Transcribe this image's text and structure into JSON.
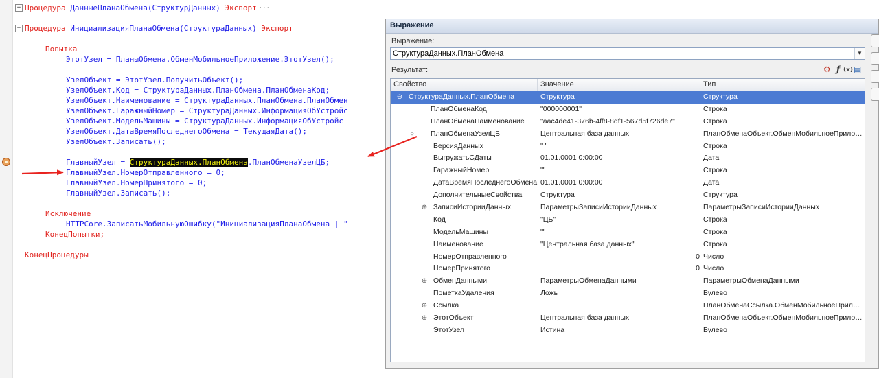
{
  "editor": {
    "lines": [
      {
        "parts": [
          {
            "t": "Процедура ",
            "k": "kw"
          },
          {
            "t": "ДанныеПланаОбмена(СтруктурДанных)",
            "k": "id"
          },
          {
            "t": " Экспорт",
            "k": "kw"
          }
        ]
      },
      {
        "parts": [
          {
            "t": "Процедура ",
            "k": "kw"
          },
          {
            "t": "ИнициализацияПланаОбмена(СтруктураДанных)",
            "k": "id"
          },
          {
            "t": " Экспорт",
            "k": "kw"
          }
        ]
      },
      {
        "parts": [
          {
            "t": "Попытка",
            "k": "kw"
          }
        ]
      },
      {
        "parts": [
          {
            "t": "ЭтотУзел = ПланыОбмена.ОбменМобильноеПриложение.ЭтотУзел();",
            "k": "id"
          }
        ]
      },
      {
        "parts": [
          {
            "t": "УзелОбъект = ЭтотУзел.ПолучитьОбъект();",
            "k": "id"
          }
        ]
      },
      {
        "parts": [
          {
            "t": "УзелОбъект.Код = СтруктураДанных.ПланОбмена.ПланОбменаКод;",
            "k": "id"
          }
        ]
      },
      {
        "parts": [
          {
            "t": "УзелОбъект.Наименование = СтруктураДанных.ПланОбмена.ПланОбмен",
            "k": "id"
          }
        ]
      },
      {
        "parts": [
          {
            "t": "УзелОбъект.ГаражныйНомер = СтруктураДанных.ИнформацияОбУстройс",
            "k": "id"
          }
        ]
      },
      {
        "parts": [
          {
            "t": "УзелОбъект.МодельМашины = СтруктураДанных.ИнформацияОбУстройс",
            "k": "id"
          }
        ]
      },
      {
        "parts": [
          {
            "t": "УзелОбъект.ДатаВремяПоследнегоОбмена = ТекущаяДата();",
            "k": "id"
          }
        ]
      },
      {
        "parts": [
          {
            "t": "УзелОбъект.Записать();",
            "k": "id"
          }
        ]
      },
      {
        "parts": [
          {
            "t": "ГлавныйУзел = ",
            "k": "id"
          },
          {
            "t": "СтруктураДанных.ПланОбмена",
            "k": "hl"
          },
          {
            "t": ".ПланОбменаУзелЦБ;",
            "k": "id"
          }
        ]
      },
      {
        "parts": [
          {
            "t": "ГлавныйУзел.НомерОтправленного = 0;",
            "k": "id"
          }
        ]
      },
      {
        "parts": [
          {
            "t": "ГлавныйУзел.НомерПринятого = 0;",
            "k": "id"
          }
        ]
      },
      {
        "parts": [
          {
            "t": "ГлавныйУзел.Записать();",
            "k": "id"
          }
        ]
      },
      {
        "parts": [
          {
            "t": "Исключение",
            "k": "kw"
          }
        ]
      },
      {
        "parts": [
          {
            "t": "HTTPCore.ЗаписатьМобильнуюОшибку(\"ИнициализацияПланаОбмена | \"",
            "k": "id"
          }
        ]
      },
      {
        "parts": [
          {
            "t": "КонецПопытки;",
            "k": "kw"
          }
        ]
      },
      {
        "parts": [
          {
            "t": "КонецПроцедуры",
            "k": "kw"
          }
        ]
      }
    ],
    "ellipsis": "...",
    "fold_collapsed": "+",
    "fold_expanded": "−"
  },
  "dialog": {
    "title": "Выражение",
    "expression_label": "Выражение:",
    "expression_value": "СтруктураДанных.ПланОбмена",
    "result_label": "Результат:",
    "dropdown_icon": "▼",
    "columns": [
      "Свойство",
      "Значение",
      "Тип"
    ],
    "rows": [
      {
        "name": "СтруктураДанных.ПланОбмена",
        "value": "Структура",
        "type": "Структура",
        "level": 0,
        "icon": "minus-circle",
        "selected": true
      },
      {
        "name": "ПланОбменаКод",
        "value": "\"000000001\"",
        "type": "Строка",
        "level": 1
      },
      {
        "name": "ПланОбменаНаименование",
        "value": "\"aac4de41-376b-4ff8-8df1-567d5f726de7\"",
        "type": "Строка",
        "level": 1
      },
      {
        "name": "ПланОбменаУзелЦБ",
        "value": "Центральная база данных",
        "type": "ПланОбменаОбъект.ОбменМобильноеПриложение",
        "level": 1,
        "icon": "circle"
      },
      {
        "name": "ВерсияДанных",
        "value": "\"          \"",
        "type": "Строка",
        "level": 2
      },
      {
        "name": "ВыгружатьСДаты",
        "value": "01.01.0001 0:00:00",
        "type": "Дата",
        "level": 2
      },
      {
        "name": "ГаражныйНомер",
        "value": "\"\"",
        "type": "Строка",
        "level": 2
      },
      {
        "name": "ДатаВремяПоследнегоОбмена",
        "value": "01.01.0001 0:00:00",
        "type": "Дата",
        "level": 2
      },
      {
        "name": "ДополнительныеСвойства",
        "value": "Структура",
        "type": "Структура",
        "level": 2
      },
      {
        "name": "ЗаписиИсторииДанных",
        "value": "ПараметрыЗаписиИсторииДанных",
        "type": "ПараметрыЗаписиИсторииДанных",
        "level": 2,
        "icon": "plus"
      },
      {
        "name": "Код",
        "value": "\"ЦБ\"",
        "type": "Строка",
        "level": 2
      },
      {
        "name": "МодельМашины",
        "value": "\"\"",
        "type": "Строка",
        "level": 2
      },
      {
        "name": "Наименование",
        "value": "\"Центральная база данных\"",
        "type": "Строка",
        "level": 2
      },
      {
        "name": "НомерОтправленного",
        "value": "0",
        "type": "Число",
        "level": 2,
        "numeric": true
      },
      {
        "name": "НомерПринятого",
        "value": "0",
        "type": "Число",
        "level": 2,
        "numeric": true
      },
      {
        "name": "ОбменДанными",
        "value": "ПараметрыОбменаДанными",
        "type": "ПараметрыОбменаДанными",
        "level": 2,
        "icon": "plus"
      },
      {
        "name": "ПометкаУдаления",
        "value": "Ложь",
        "type": "Булево",
        "level": 2
      },
      {
        "name": "Ссылка",
        "value": "",
        "type": "ПланОбменаСсылка.ОбменМобильноеПриложение",
        "level": 2,
        "icon": "plus"
      },
      {
        "name": "ЭтотОбъект",
        "value": "Центральная база данных",
        "type": "ПланОбменаОбъект.ОбменМобильноеПриложение",
        "level": 2,
        "icon": "plus"
      },
      {
        "name": "ЭтотУзел",
        "value": "Истина",
        "type": "Булево",
        "level": 2
      }
    ]
  },
  "colors": {
    "keyword": "#e1241f",
    "identifier": "#1e1ee8",
    "highlight_bg": "#0b0b0b",
    "highlight_fg": "#f3f20c",
    "selection": "#4c7bd3",
    "arrow": "#e8231f"
  },
  "icons": {
    "breakpoint": "breakpoint-icon",
    "tree_minus": "⊖",
    "tree_circle": "○",
    "tree_plus": "⊕"
  }
}
